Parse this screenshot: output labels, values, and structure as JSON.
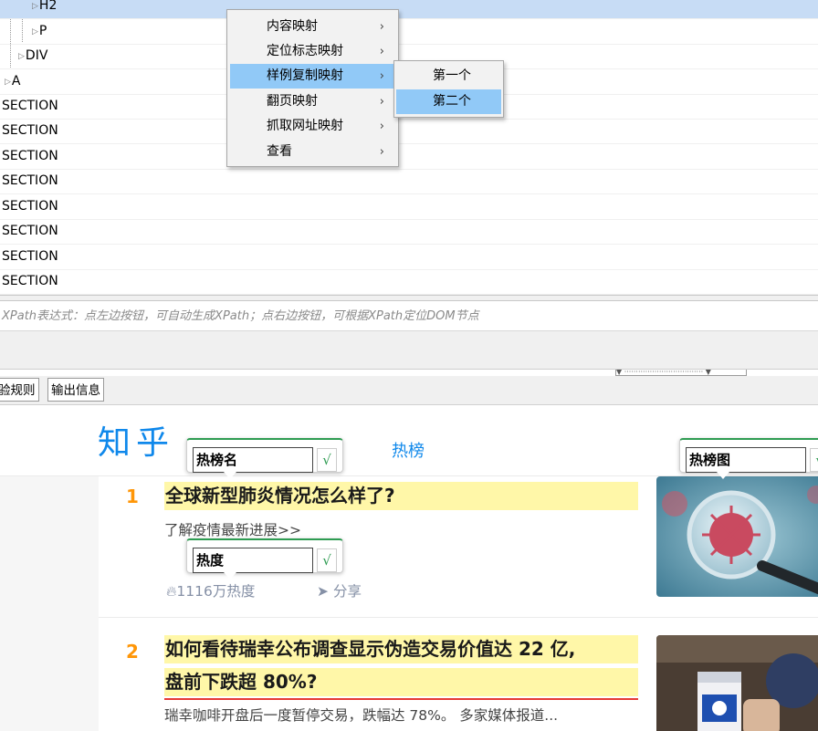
{
  "tree": {
    "rows": [
      {
        "label": "H2",
        "expander": "▷"
      },
      {
        "label": "P",
        "expander": "▷"
      },
      {
        "label": "DIV",
        "expander": "▷"
      },
      {
        "label": "A",
        "expander": "▷"
      },
      {
        "label": "SECTION"
      },
      {
        "label": "SECTION"
      },
      {
        "label": "SECTION"
      },
      {
        "label": "SECTION"
      },
      {
        "label": "SECTION"
      },
      {
        "label": "SECTION"
      },
      {
        "label": "SECTION"
      },
      {
        "label": "SECTION"
      }
    ]
  },
  "context_menu": {
    "items": [
      {
        "label": "内容映射",
        "arrow": "›"
      },
      {
        "label": "定位标志映射",
        "arrow": "›"
      },
      {
        "label": "样例复制映射",
        "arrow": "›"
      },
      {
        "label": "翻页映射",
        "arrow": "›"
      },
      {
        "label": "抓取网址映射",
        "arrow": "›"
      },
      {
        "label": "查看",
        "arrow": "›"
      }
    ],
    "submenu": [
      "第一个",
      "第二个"
    ]
  },
  "xpath": {
    "placeholder": "XPath表达式：点左边按钮，可自动生成XPath；点右边按钮，可根据XPath定位DOM节点"
  },
  "tabs": [
    "验规则",
    "输出信息"
  ],
  "web": {
    "logo": "知乎",
    "nav_hot": "热榜",
    "items": [
      {
        "rank": "1",
        "title": "全球新型肺炎情况怎么样了?",
        "subtitle": "了解疫情最新进展>>",
        "heat": "1116",
        "heat_suffix": "万热度",
        "share": "分享"
      },
      {
        "rank": "2",
        "title_line1": "如何看待瑞幸公布调查显示伪造交易价值达 22 亿,",
        "title_line2": "盘前下跌超 80%?",
        "subtitle": "瑞幸咖啡开盘后一度暂停交易，跌幅达 78%。 多家媒体报道..."
      }
    ],
    "labels": [
      {
        "name": "热榜名",
        "check": "√"
      },
      {
        "name": "热度",
        "check": "√"
      },
      {
        "name": "热榜图",
        "check": "√"
      }
    ]
  }
}
